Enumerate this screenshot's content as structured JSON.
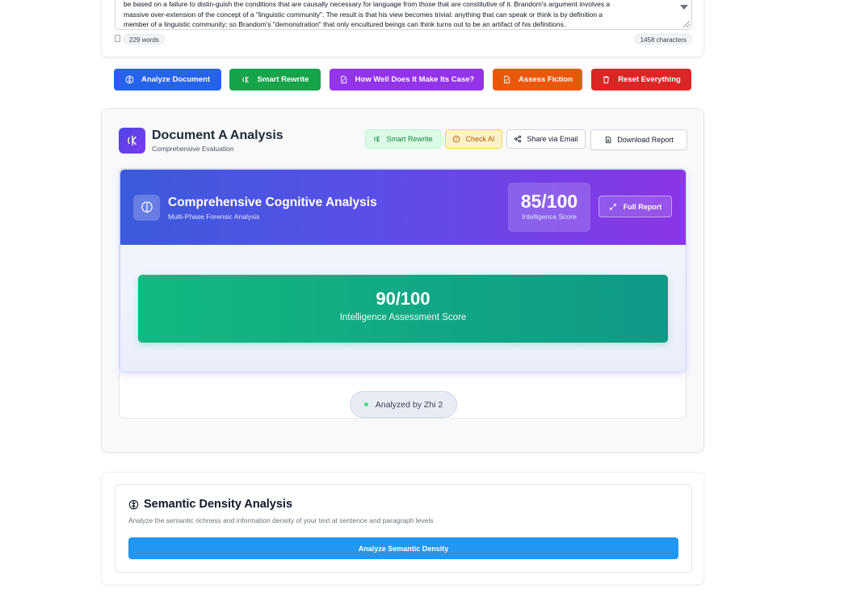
{
  "input": {
    "text_lines": [
      "be based on a failure to distin-guish the conditions that are causally necessary for language from those that are constitutive of it. Brandom's argument involves a",
      "massive over-extension of the concept of a \"linguistic community\". The result is that his view becomes trivial: anything that can speak or think is by definition a",
      "member of a linguistic community; so Brandom's \"demonstration\" that only encultured beings can think turns out to be an artifact of his definitions."
    ],
    "word_count": "229 words",
    "char_count": "1458 characters"
  },
  "actions": {
    "analyze": "Analyze Document",
    "rewrite": "Smart Rewrite",
    "case": "How Well Does It Make Its Case?",
    "fiction": "Assess Fiction",
    "reset": "Reset Everything"
  },
  "colors": {
    "analyze": "#2563eb",
    "rewrite": "#16a34a",
    "case": "#9333ea",
    "fiction": "#ea580c",
    "reset": "#dc2626"
  },
  "analysis": {
    "title": "Document A Analysis",
    "subtitle": "Comprehensive Evaluation",
    "tools": {
      "smart_rewrite": "Smart Rewrite",
      "check_ai": "Check AI",
      "share": "Share via Email",
      "download": "Download Report"
    },
    "cognitive": {
      "title": "Comprehensive Cognitive Analysis",
      "subtitle": "Multi-Phase Forensic Analysis",
      "score": "85/100",
      "score_label": "Intelligence Score",
      "full_report": "Full Report"
    },
    "assessment": {
      "score": "90/100",
      "label": "Intelligence Assessment Score"
    },
    "analyzed_by": "Analyzed by Zhi 2"
  },
  "semantic": {
    "title": "Semantic Density Analysis",
    "description": "Analyze the semantic richness and information density of your text at sentence and paragraph levels",
    "button": "Analyze Semantic Density"
  },
  "icons": [
    "document-icon",
    "brain-icon",
    "rewrite-icon",
    "file-icon",
    "trash-icon",
    "alert-icon",
    "share-icon",
    "download-icon",
    "expand-icon"
  ]
}
